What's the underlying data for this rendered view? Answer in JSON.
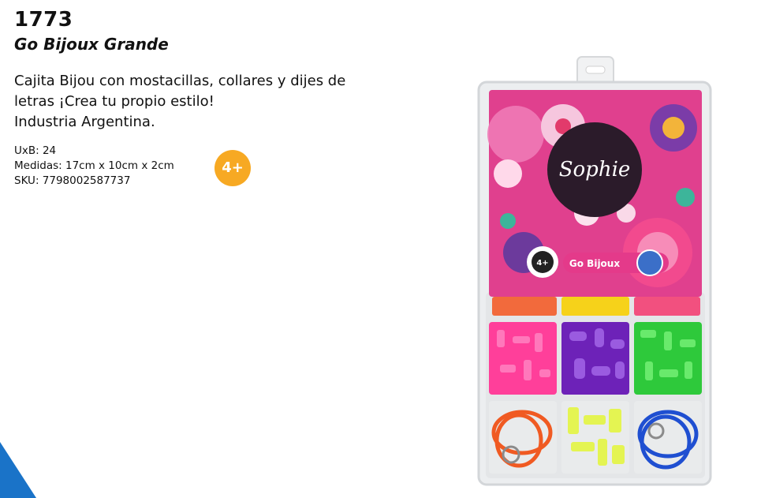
{
  "product": {
    "code": "1773",
    "name": "Go Bijoux Grande",
    "description_lines": [
      "Cajita Bijou con mostacillas, collares y dijes de",
      "letras ¡Crea tu propio estilo!",
      "Industria Argentina."
    ],
    "specs": {
      "uxb": "UxB: 24",
      "measures": "Medidas: 17cm x 10cm x 2cm",
      "sku": "SKU: 7798002587737"
    },
    "age_badge": "4+"
  },
  "package_label": {
    "brand": "Sophie",
    "line": "Go Bijoux",
    "age": "4+"
  },
  "colors": {
    "badge": "#f7a923",
    "accent_blue": "#1a73c8",
    "pink_box": "#e0408e"
  }
}
